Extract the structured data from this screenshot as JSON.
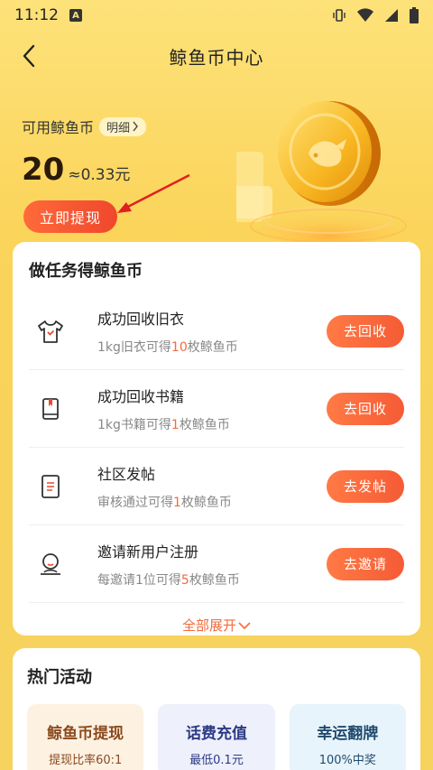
{
  "status": {
    "time": "11:12",
    "a_icon": "A"
  },
  "nav": {
    "title": "鲸鱼币中心"
  },
  "balance": {
    "label": "可用鲸鱼币",
    "detail": "明细",
    "amount": "20",
    "approx": "≈0.33元",
    "withdraw_label": "立即提现"
  },
  "tasks": {
    "title": "做任务得鲸鱼币",
    "items": [
      {
        "icon": "shirt-icon",
        "title": "成功回收旧衣",
        "desc_pre": "1kg旧衣可得",
        "desc_num": "10",
        "desc_post": "枚鲸鱼币",
        "button": "去回收"
      },
      {
        "icon": "book-icon",
        "title": "成功回收书籍",
        "desc_pre": "1kg书籍可得",
        "desc_num": "1",
        "desc_post": "枚鲸鱼币",
        "button": "去回收"
      },
      {
        "icon": "document-icon",
        "title": "社区发帖",
        "desc_pre": "审核通过可得",
        "desc_num": "1",
        "desc_post": "枚鲸鱼币",
        "button": "去发帖"
      },
      {
        "icon": "user-avatar-icon",
        "title": "邀请新用户注册",
        "desc_pre": "每邀请1位可得",
        "desc_num": "5",
        "desc_post": "枚鲸鱼币",
        "button": "去邀请"
      }
    ],
    "expand_label": "全部展开"
  },
  "hot": {
    "title": "热门活动",
    "items": [
      {
        "title": "鲸鱼币提现",
        "sub": "提现比率60:1",
        "bg": "#fdf1e2",
        "color": "#8a4a1e"
      },
      {
        "title": "话费充值",
        "sub": "最低0.1元",
        "bg": "#eef0fb",
        "color": "#2c3a86"
      },
      {
        "title": "幸运翻牌",
        "sub": "100%中奖",
        "bg": "#e8f4fb",
        "color": "#1f4a6e"
      }
    ]
  },
  "colors": {
    "accent": "#f55b35",
    "background": "#fbd45a",
    "highlight": "#f46a3a"
  }
}
